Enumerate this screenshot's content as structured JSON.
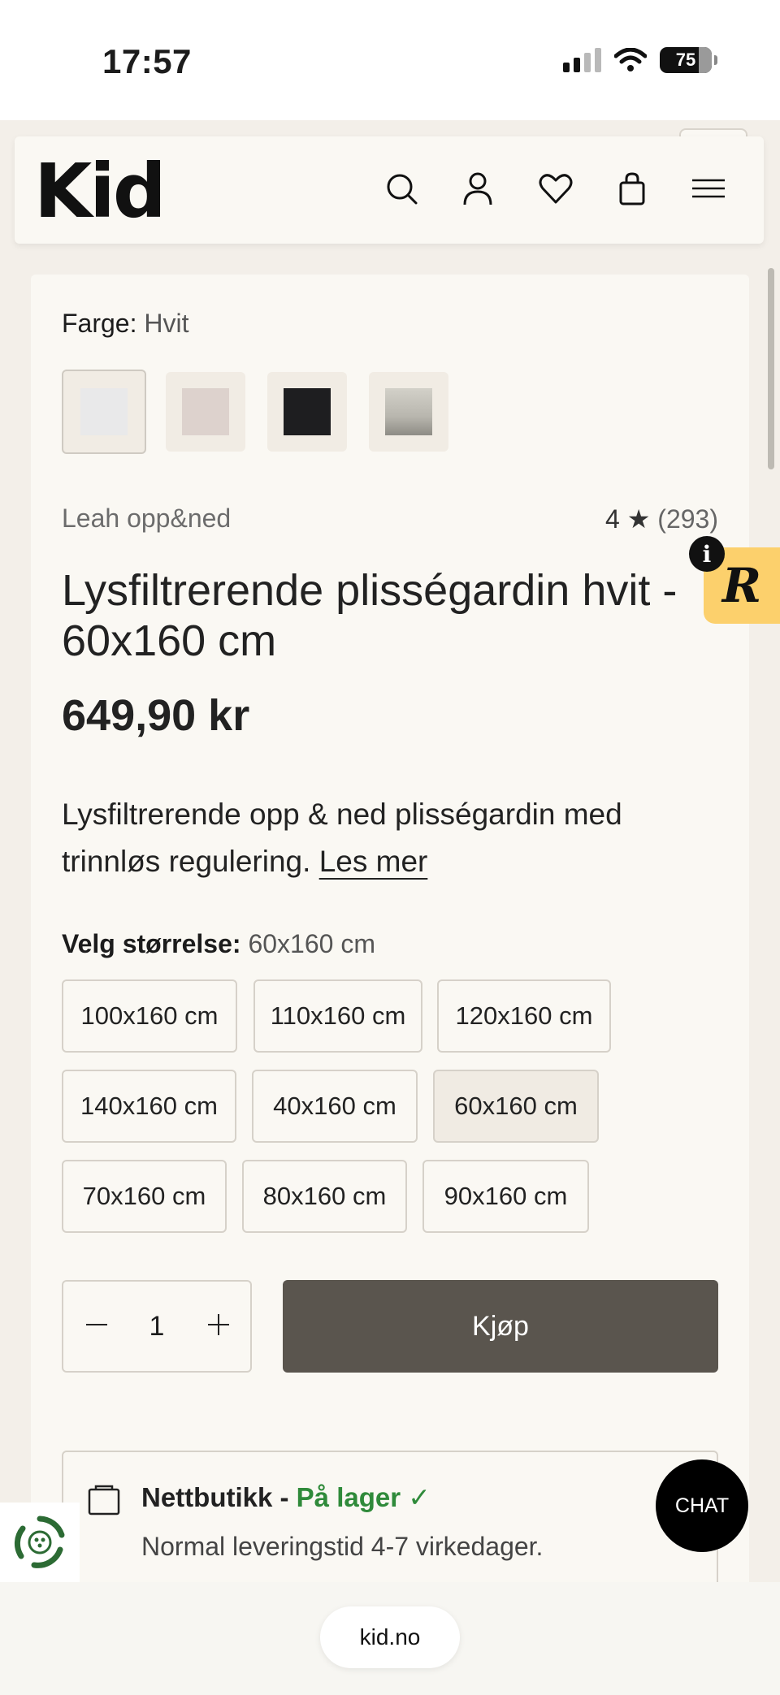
{
  "status_bar": {
    "time": "17:57",
    "battery": "75"
  },
  "header": {
    "logo": "Kid"
  },
  "product": {
    "color_label": "Farge:",
    "color_value": "Hvit",
    "swatches": [
      {
        "name": "Hvit",
        "color": "#e9e9ea"
      },
      {
        "name": "Beige",
        "color": "#ddd2cd"
      },
      {
        "name": "Svart",
        "color": "#1e1e20"
      },
      {
        "name": "Grå",
        "color": "#b8b6ae"
      }
    ],
    "brand": "Leah opp&ned",
    "rating": "4",
    "rating_star": "★",
    "review_count": "(293)",
    "title": "Lysfiltrerende plisségardin hvit - 60x160 cm",
    "price": "649,90 kr",
    "description": "Lysfiltrerende opp & ned plisségardin med trinnløs regulering.",
    "read_more": "Les mer",
    "size_label": "Velg størrelse:",
    "size_value": "60x160 cm",
    "sizes": [
      "100x160 cm",
      "110x160 cm",
      "120x160 cm",
      "140x160 cm",
      "40x160 cm",
      "60x160 cm",
      "70x160 cm",
      "80x160 cm",
      "90x160 cm"
    ],
    "selected_size": "60x160 cm",
    "quantity": "1",
    "buy_label": "Kjøp"
  },
  "stock": {
    "store": "Nettbutikk -",
    "status": "På lager ✓",
    "delivery": "Normal leveringstid 4-7 virkedager."
  },
  "widgets": {
    "chat_label": "CHAT",
    "reviews_letter": "R",
    "info_letter": "i"
  },
  "browser": {
    "url": "kid.no"
  },
  "colors": {
    "buy_button": "#5a554e",
    "in_stock": "#2f8a3a",
    "background": "#f3efe9",
    "card": "#faf8f3"
  }
}
